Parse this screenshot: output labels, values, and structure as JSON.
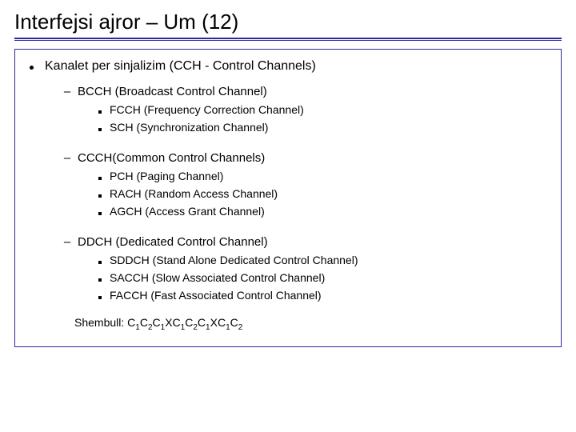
{
  "title": "Interfejsi ajror – Um (12)",
  "heading": "Kanalet per sinjalizim (CCH - Control Channels)",
  "sections": [
    {
      "title": "BCCH (Broadcast Control Channel)",
      "items": [
        "FCCH (Frequency Correction Channel)",
        "SCH (Synchronization Channel)"
      ]
    },
    {
      "title": "CCCH(Common Control Channels)",
      "items": [
        "PCH (Paging Channel)",
        "RACH (Random Access Channel)",
        "AGCH (Access Grant Channel)"
      ]
    },
    {
      "title": "DDCH (Dedicated  Control Channel)",
      "items": [
        "SDDCH (Stand Alone Dedicated  Control Channel)",
        "SACCH (Slow Associated Control Channel)",
        "FACCH (Fast Associated Control Channel)"
      ]
    }
  ],
  "example_label": "Shembull: ",
  "example_sequence": "C1C2C1XC1C2C1XC1C2"
}
